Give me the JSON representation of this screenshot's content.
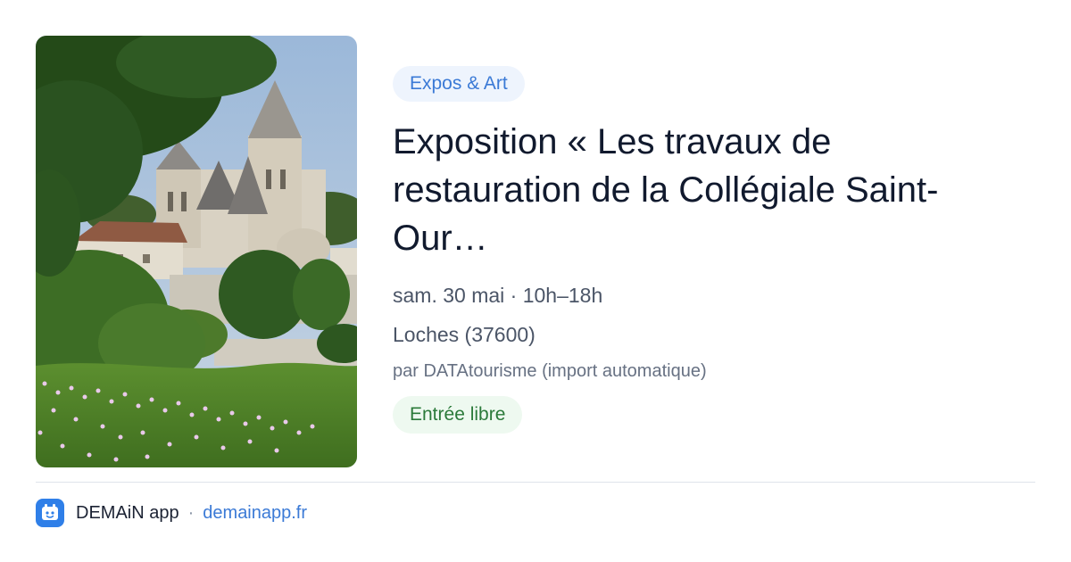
{
  "card": {
    "category": "Expos & Art",
    "title": "Exposition « Les travaux de restauration de la Collégiale Saint-Our…",
    "date_time": "sam. 30 mai · 10h–18h",
    "location": "Loches (37600)",
    "source": "par DATAtourisme (import automatique)",
    "price": "Entrée libre"
  },
  "footer": {
    "app_name": "DEMAiN app",
    "separator": "·",
    "url": "demainapp.fr",
    "icon": "demain-app-icon"
  },
  "colors": {
    "accent": "#3b7ad6",
    "tag_bg": "#eef4fd",
    "price_text": "#2b7a3a",
    "price_bg": "#eef9f0",
    "title": "#111a2e"
  }
}
